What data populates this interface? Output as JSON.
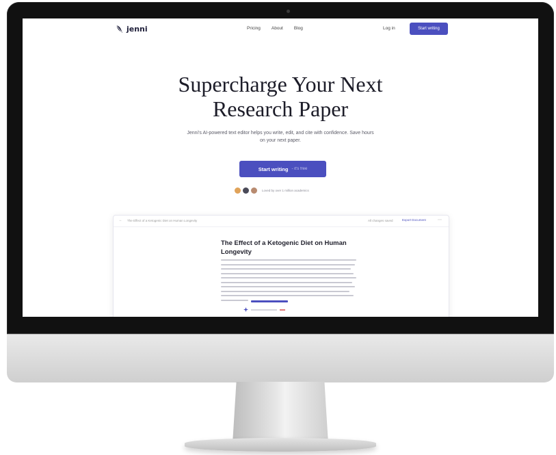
{
  "nav": {
    "logo_text": "jenni",
    "links": [
      "Pricing",
      "About",
      "Blog"
    ],
    "login_label": "Log in",
    "signup_label": "Start writing"
  },
  "hero": {
    "headline_line1": "Supercharge Your Next",
    "headline_line2": "Research Paper",
    "subtext": "Jenni's AI-powered text editor helps you write, edit, and cite with confidence. Save hours on your next paper.",
    "cta_label": "Start writing",
    "cta_sub": "- it's free",
    "trust_text": "Loved by over 1 million academics"
  },
  "editor": {
    "doc_name": "The Effect of a Ketogenic Diet on Human Longevity",
    "status": "All changes saved",
    "export_label": "Export Document",
    "doc_title": "The Effect of a Ketogenic Diet on Human Longevity"
  },
  "colors": {
    "accent": "#4b4fbf",
    "headline": "#1c1c28",
    "bezel": "#111111"
  }
}
